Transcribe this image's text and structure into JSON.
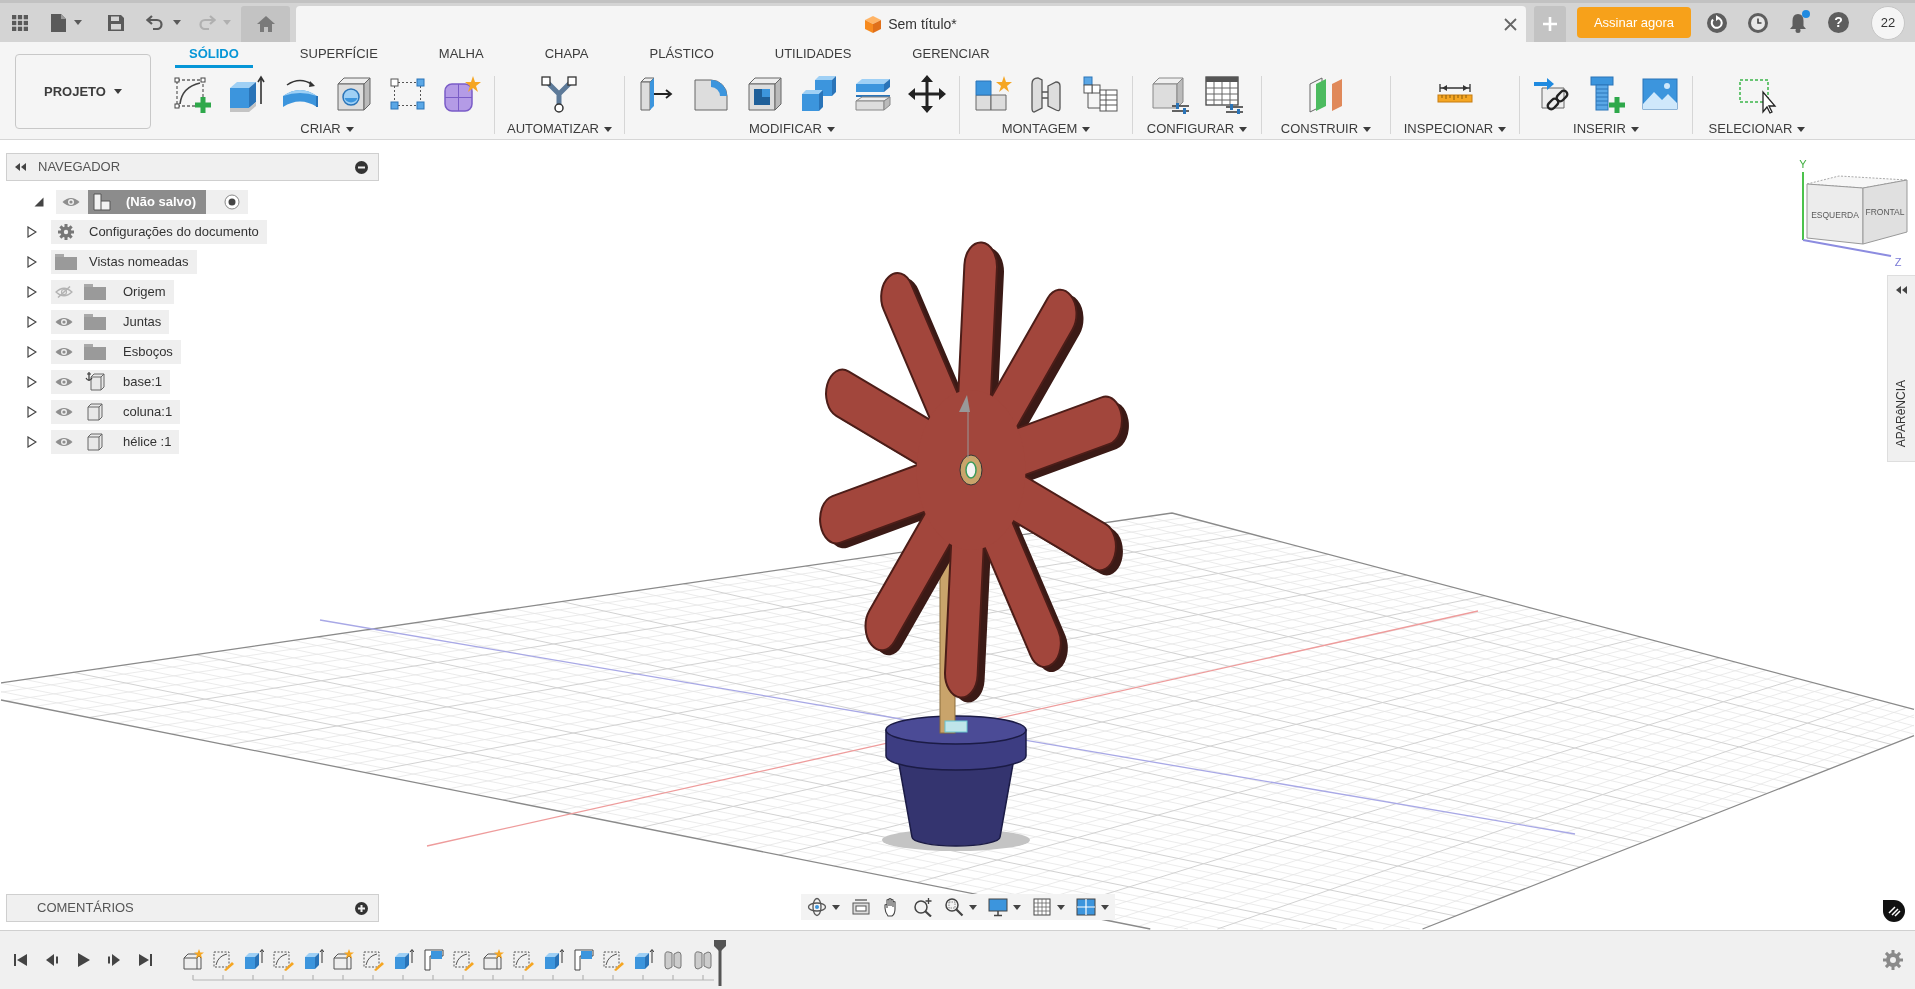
{
  "top_bar": {
    "undo": {
      "disabled": false
    },
    "redo": {
      "disabled": true
    },
    "document_tab": {
      "title": "Sem título*"
    },
    "subscribe_button": "Assinar agora",
    "notifications": {
      "unread": true
    },
    "help_button": "?",
    "user_badge": "22"
  },
  "ribbon": {
    "project_button": "PROJETO",
    "tabs": [
      {
        "label": "SÓLIDO",
        "selected": true
      },
      {
        "label": "SUPERFÍCIE",
        "selected": false
      },
      {
        "label": "MALHA",
        "selected": false
      },
      {
        "label": "CHAPA",
        "selected": false
      },
      {
        "label": "PLÁSTICO",
        "selected": false
      },
      {
        "label": "UTILIDADES",
        "selected": false
      },
      {
        "label": "GERENCIAR",
        "selected": false
      }
    ],
    "groups": [
      {
        "label": "CRIAR",
        "tools": [
          {
            "kind": "sketch"
          },
          {
            "kind": "extrude"
          },
          {
            "kind": "revolve"
          },
          {
            "kind": "hole"
          },
          {
            "kind": "pattern"
          },
          {
            "kind": "form"
          }
        ]
      },
      {
        "label": "AUTOMATIZAR",
        "tools": [
          {
            "kind": "automate"
          }
        ]
      },
      {
        "label": "MODIFICAR",
        "tools": [
          {
            "kind": "presspull"
          },
          {
            "kind": "fillet"
          },
          {
            "kind": "shell"
          },
          {
            "kind": "combine"
          },
          {
            "kind": "split"
          },
          {
            "kind": "move"
          }
        ]
      },
      {
        "label": "MONTAGEM",
        "tools": [
          {
            "kind": "newcomponent"
          },
          {
            "kind": "joint"
          },
          {
            "kind": "bom"
          }
        ]
      },
      {
        "label": "CONFIGURAR",
        "tools": [
          {
            "kind": "configbox"
          },
          {
            "kind": "configtable"
          }
        ]
      },
      {
        "label": "CONSTRUIR",
        "tools": [
          {
            "kind": "plane"
          }
        ]
      },
      {
        "label": "INSPECIONAR",
        "tools": [
          {
            "kind": "measure"
          }
        ]
      },
      {
        "label": "INSERIR",
        "tools": [
          {
            "kind": "insertlink"
          },
          {
            "kind": "fastener"
          },
          {
            "kind": "image"
          }
        ]
      },
      {
        "label": "SELECIONAR",
        "tools": [
          {
            "kind": "select"
          }
        ]
      }
    ]
  },
  "navigator": {
    "title": "NAVEGADOR",
    "root": {
      "label": "(Não salvo)",
      "expanded": true,
      "visible": true,
      "active": true,
      "children": [
        {
          "label": "Configurações do documento",
          "kind": "settings",
          "expanded": false
        },
        {
          "label": "Vistas nomeadas",
          "kind": "folder",
          "expanded": false
        },
        {
          "label": "Origem",
          "kind": "folder",
          "expanded": false,
          "visible": false
        },
        {
          "label": "Juntas",
          "kind": "folder",
          "expanded": false,
          "visible": true
        },
        {
          "label": "Esboços",
          "kind": "folder",
          "expanded": false,
          "visible": true
        },
        {
          "label": "base:1",
          "kind": "grounded",
          "expanded": false,
          "visible": true
        },
        {
          "label": "coluna:1",
          "kind": "component",
          "expanded": false,
          "visible": true
        },
        {
          "label": "hélice :1",
          "kind": "component",
          "expanded": false,
          "visible": true
        }
      ]
    }
  },
  "view_cube": {
    "faces": [
      "ESQUERDA",
      "FRONTAL"
    ],
    "axes": [
      "Y",
      "Z"
    ]
  },
  "appearance_panel": {
    "title": "APARêNCIA"
  },
  "comments_panel": {
    "title": "COMENTÁRIOS"
  },
  "timeline": {
    "features": [
      {
        "kind": "component"
      },
      {
        "kind": "sketch"
      },
      {
        "kind": "extrude"
      },
      {
        "kind": "sketch"
      },
      {
        "kind": "extrude"
      },
      {
        "kind": "component"
      },
      {
        "kind": "sketch"
      },
      {
        "kind": "extrude"
      },
      {
        "kind": "profile"
      },
      {
        "kind": "sketch"
      },
      {
        "kind": "component"
      },
      {
        "kind": "sketch"
      },
      {
        "kind": "extrude"
      },
      {
        "kind": "profile"
      },
      {
        "kind": "sketch"
      },
      {
        "kind": "extrude"
      },
      {
        "kind": "joint"
      },
      {
        "kind": "joint"
      }
    ]
  }
}
